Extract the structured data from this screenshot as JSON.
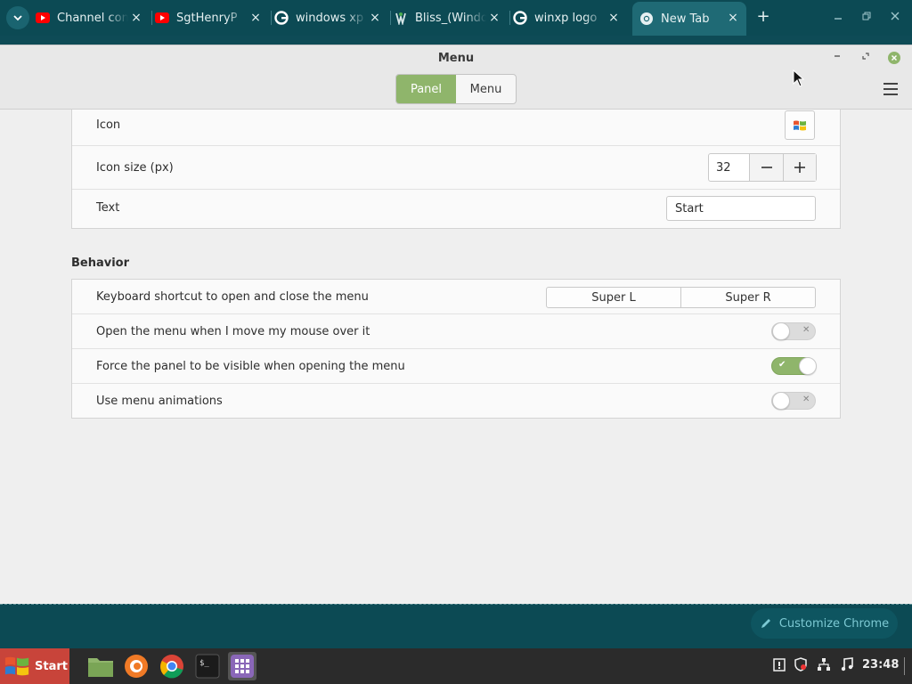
{
  "browser": {
    "tabs": [
      {
        "title": "Channel content",
        "favicon": "youtube-icon"
      },
      {
        "title": "SgtHenryP",
        "favicon": "youtube-icon"
      },
      {
        "title": "windows xp",
        "favicon": "google-icon"
      },
      {
        "title": "Bliss_(Windows",
        "favicon": "wikipedia-icon"
      },
      {
        "title": "winxp logo",
        "favicon": "google-icon"
      },
      {
        "title": "New Tab",
        "favicon": "chrome-icon",
        "active": true
      }
    ],
    "close_symbol": "×",
    "new_tab_symbol": "+",
    "customize_label": "Customize Chrome"
  },
  "dialog": {
    "title": "Menu",
    "stack": {
      "panel": "Panel",
      "menu": "Menu",
      "active": "Panel"
    },
    "appearance": {
      "icon_label": "Icon",
      "icon_size_label": "Icon size (px)",
      "icon_size_value": "32",
      "text_label": "Text",
      "text_value": "Start"
    },
    "behavior": {
      "title": "Behavior",
      "keyboard_label": "Keyboard shortcut to open and close the menu",
      "keybind_1": "Super L",
      "keybind_2": "Super R",
      "hover_label": "Open the menu when I move my mouse over it",
      "hover_on": false,
      "force_panel_label": "Force the panel to be visible when opening the menu",
      "force_panel_on": true,
      "animations_label": "Use menu animations",
      "animations_on": false
    },
    "accent_color": "#8fb56b"
  },
  "taskbar": {
    "start_label": "Start",
    "clock": "23:48",
    "apps": [
      "files-icon",
      "firefox-icon",
      "chrome-icon",
      "terminal-icon",
      "app-grid-icon"
    ]
  }
}
